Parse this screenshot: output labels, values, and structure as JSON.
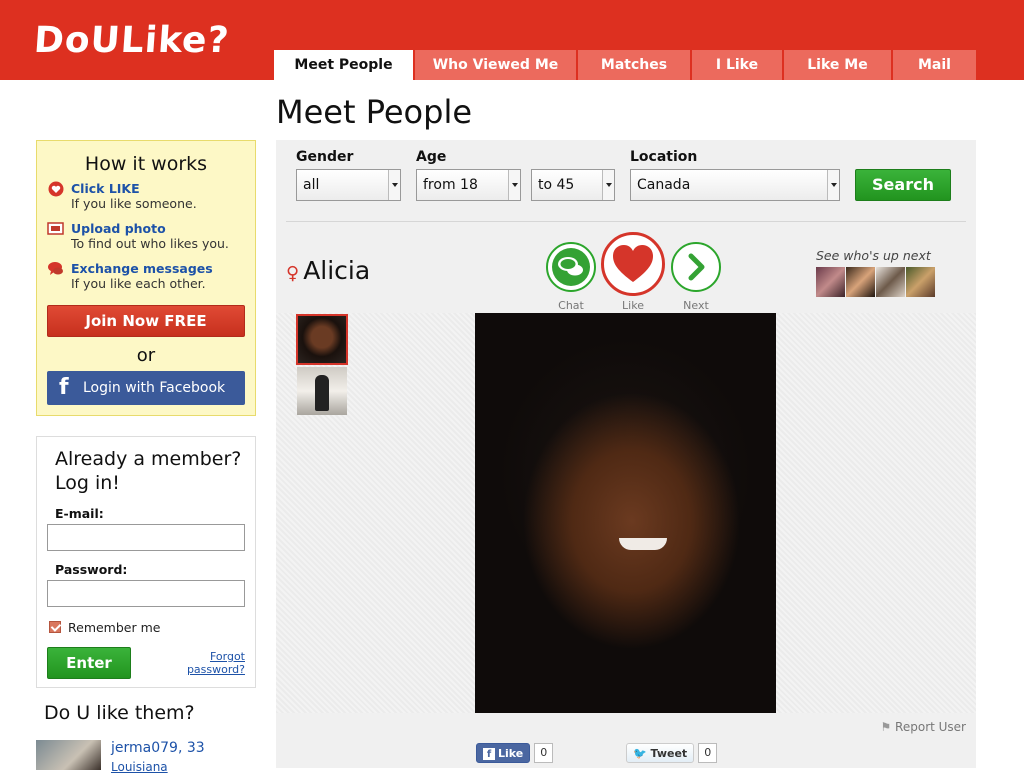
{
  "app": {
    "logo_text": "DoULike?",
    "brand_color": "#dd3020"
  },
  "tabs": [
    {
      "label": "Meet People",
      "active": true
    },
    {
      "label": "Who Viewed Me"
    },
    {
      "label": "Matches"
    },
    {
      "label": "I Like"
    },
    {
      "label": "Like Me"
    },
    {
      "label": "Mail"
    }
  ],
  "page_title": "Meet People",
  "how_it_works": {
    "title": "How it works",
    "items": [
      {
        "icon": "heart-icon",
        "title": "Click LIKE",
        "desc": "If you like someone."
      },
      {
        "icon": "photo-icon",
        "title": "Upload photo",
        "desc": "To find out who likes you."
      },
      {
        "icon": "chat-icon",
        "title": "Exchange messages",
        "desc": "If you like each other."
      }
    ],
    "join_label": "Join Now FREE",
    "or_text": "or",
    "facebook_label": "Login with Facebook"
  },
  "login": {
    "title": "Already a member? Log in!",
    "email_label": "E-mail:",
    "email_value": "",
    "password_label": "Password:",
    "password_value": "",
    "remember_label": "Remember me",
    "remember_checked": true,
    "enter_label": "Enter",
    "forgot_line1": "Forgot",
    "forgot_line2": "password?"
  },
  "do_u_like": {
    "title": "Do U like them?",
    "user": "jerma079, 33",
    "location": "Louisiana"
  },
  "filters": {
    "gender_label": "Gender",
    "gender_value": "all",
    "age_label": "Age",
    "age_from": "from 18",
    "age_to": "to 45",
    "location_label": "Location",
    "location_value": "Canada",
    "search_label": "Search"
  },
  "profile": {
    "sex_symbol": "♀",
    "name": "Alicia"
  },
  "actions": {
    "chat_label": "Chat",
    "like_label": "Like",
    "next_label": "Next"
  },
  "next_up_title": "See who's up next",
  "report_label": "Report User",
  "social": {
    "fb_like_label": "Like",
    "fb_like_count": "0",
    "tweet_label": "Tweet",
    "tweet_count": "0"
  }
}
